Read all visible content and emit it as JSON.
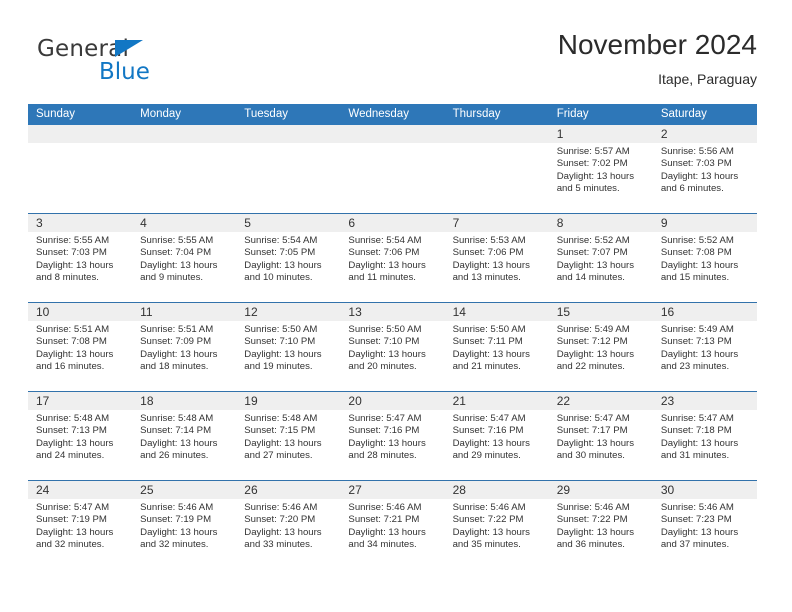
{
  "brand": {
    "name_part1": "General",
    "name_part2": "Blue",
    "accent_color": "#1277c4"
  },
  "header": {
    "title": "November 2024",
    "subtitle": "Itape, Paraguay"
  },
  "theme": {
    "header_blue": "#2e77b8",
    "day_band_gray": "#efefef",
    "row_divider": "#3272ab"
  },
  "weekdays": [
    "Sunday",
    "Monday",
    "Tuesday",
    "Wednesday",
    "Thursday",
    "Friday",
    "Saturday"
  ],
  "weeks": [
    [
      {
        "day": "",
        "empty": true
      },
      {
        "day": "",
        "empty": true
      },
      {
        "day": "",
        "empty": true
      },
      {
        "day": "",
        "empty": true
      },
      {
        "day": "",
        "empty": true
      },
      {
        "day": "1",
        "sunrise": "Sunrise: 5:57 AM",
        "sunset": "Sunset: 7:02 PM",
        "daylight": "Daylight: 13 hours and 5 minutes."
      },
      {
        "day": "2",
        "sunrise": "Sunrise: 5:56 AM",
        "sunset": "Sunset: 7:03 PM",
        "daylight": "Daylight: 13 hours and 6 minutes."
      }
    ],
    [
      {
        "day": "3",
        "sunrise": "Sunrise: 5:55 AM",
        "sunset": "Sunset: 7:03 PM",
        "daylight": "Daylight: 13 hours and 8 minutes."
      },
      {
        "day": "4",
        "sunrise": "Sunrise: 5:55 AM",
        "sunset": "Sunset: 7:04 PM",
        "daylight": "Daylight: 13 hours and 9 minutes."
      },
      {
        "day": "5",
        "sunrise": "Sunrise: 5:54 AM",
        "sunset": "Sunset: 7:05 PM",
        "daylight": "Daylight: 13 hours and 10 minutes."
      },
      {
        "day": "6",
        "sunrise": "Sunrise: 5:54 AM",
        "sunset": "Sunset: 7:06 PM",
        "daylight": "Daylight: 13 hours and 11 minutes."
      },
      {
        "day": "7",
        "sunrise": "Sunrise: 5:53 AM",
        "sunset": "Sunset: 7:06 PM",
        "daylight": "Daylight: 13 hours and 13 minutes."
      },
      {
        "day": "8",
        "sunrise": "Sunrise: 5:52 AM",
        "sunset": "Sunset: 7:07 PM",
        "daylight": "Daylight: 13 hours and 14 minutes."
      },
      {
        "day": "9",
        "sunrise": "Sunrise: 5:52 AM",
        "sunset": "Sunset: 7:08 PM",
        "daylight": "Daylight: 13 hours and 15 minutes."
      }
    ],
    [
      {
        "day": "10",
        "sunrise": "Sunrise: 5:51 AM",
        "sunset": "Sunset: 7:08 PM",
        "daylight": "Daylight: 13 hours and 16 minutes."
      },
      {
        "day": "11",
        "sunrise": "Sunrise: 5:51 AM",
        "sunset": "Sunset: 7:09 PM",
        "daylight": "Daylight: 13 hours and 18 minutes."
      },
      {
        "day": "12",
        "sunrise": "Sunrise: 5:50 AM",
        "sunset": "Sunset: 7:10 PM",
        "daylight": "Daylight: 13 hours and 19 minutes."
      },
      {
        "day": "13",
        "sunrise": "Sunrise: 5:50 AM",
        "sunset": "Sunset: 7:10 PM",
        "daylight": "Daylight: 13 hours and 20 minutes."
      },
      {
        "day": "14",
        "sunrise": "Sunrise: 5:50 AM",
        "sunset": "Sunset: 7:11 PM",
        "daylight": "Daylight: 13 hours and 21 minutes."
      },
      {
        "day": "15",
        "sunrise": "Sunrise: 5:49 AM",
        "sunset": "Sunset: 7:12 PM",
        "daylight": "Daylight: 13 hours and 22 minutes."
      },
      {
        "day": "16",
        "sunrise": "Sunrise: 5:49 AM",
        "sunset": "Sunset: 7:13 PM",
        "daylight": "Daylight: 13 hours and 23 minutes."
      }
    ],
    [
      {
        "day": "17",
        "sunrise": "Sunrise: 5:48 AM",
        "sunset": "Sunset: 7:13 PM",
        "daylight": "Daylight: 13 hours and 24 minutes."
      },
      {
        "day": "18",
        "sunrise": "Sunrise: 5:48 AM",
        "sunset": "Sunset: 7:14 PM",
        "daylight": "Daylight: 13 hours and 26 minutes."
      },
      {
        "day": "19",
        "sunrise": "Sunrise: 5:48 AM",
        "sunset": "Sunset: 7:15 PM",
        "daylight": "Daylight: 13 hours and 27 minutes."
      },
      {
        "day": "20",
        "sunrise": "Sunrise: 5:47 AM",
        "sunset": "Sunset: 7:16 PM",
        "daylight": "Daylight: 13 hours and 28 minutes."
      },
      {
        "day": "21",
        "sunrise": "Sunrise: 5:47 AM",
        "sunset": "Sunset: 7:16 PM",
        "daylight": "Daylight: 13 hours and 29 minutes."
      },
      {
        "day": "22",
        "sunrise": "Sunrise: 5:47 AM",
        "sunset": "Sunset: 7:17 PM",
        "daylight": "Daylight: 13 hours and 30 minutes."
      },
      {
        "day": "23",
        "sunrise": "Sunrise: 5:47 AM",
        "sunset": "Sunset: 7:18 PM",
        "daylight": "Daylight: 13 hours and 31 minutes."
      }
    ],
    [
      {
        "day": "24",
        "sunrise": "Sunrise: 5:47 AM",
        "sunset": "Sunset: 7:19 PM",
        "daylight": "Daylight: 13 hours and 32 minutes."
      },
      {
        "day": "25",
        "sunrise": "Sunrise: 5:46 AM",
        "sunset": "Sunset: 7:19 PM",
        "daylight": "Daylight: 13 hours and 32 minutes."
      },
      {
        "day": "26",
        "sunrise": "Sunrise: 5:46 AM",
        "sunset": "Sunset: 7:20 PM",
        "daylight": "Daylight: 13 hours and 33 minutes."
      },
      {
        "day": "27",
        "sunrise": "Sunrise: 5:46 AM",
        "sunset": "Sunset: 7:21 PM",
        "daylight": "Daylight: 13 hours and 34 minutes."
      },
      {
        "day": "28",
        "sunrise": "Sunrise: 5:46 AM",
        "sunset": "Sunset: 7:22 PM",
        "daylight": "Daylight: 13 hours and 35 minutes."
      },
      {
        "day": "29",
        "sunrise": "Sunrise: 5:46 AM",
        "sunset": "Sunset: 7:22 PM",
        "daylight": "Daylight: 13 hours and 36 minutes."
      },
      {
        "day": "30",
        "sunrise": "Sunrise: 5:46 AM",
        "sunset": "Sunset: 7:23 PM",
        "daylight": "Daylight: 13 hours and 37 minutes."
      }
    ]
  ]
}
